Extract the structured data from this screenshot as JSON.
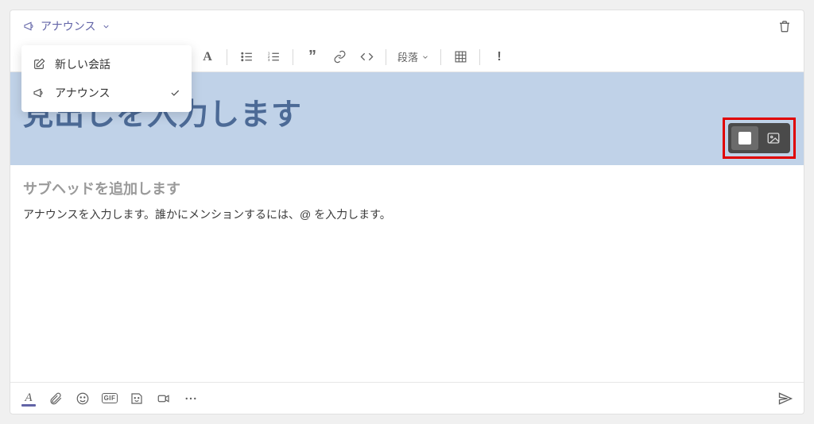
{
  "typeSelector": {
    "label": "アナウンス"
  },
  "dropdown": {
    "newConversation": "新しい会話",
    "announcement": "アナウンス"
  },
  "toolbar": {
    "paragraph": "段落"
  },
  "headline": {
    "placeholder": "見出しを入力します"
  },
  "subhead": {
    "placeholder": "サブヘッドを追加します"
  },
  "body": {
    "placeholder": "アナウンスを入力します。誰かにメンションするには、@ を入力します。"
  },
  "bottomBar": {
    "gif": "GIF"
  }
}
